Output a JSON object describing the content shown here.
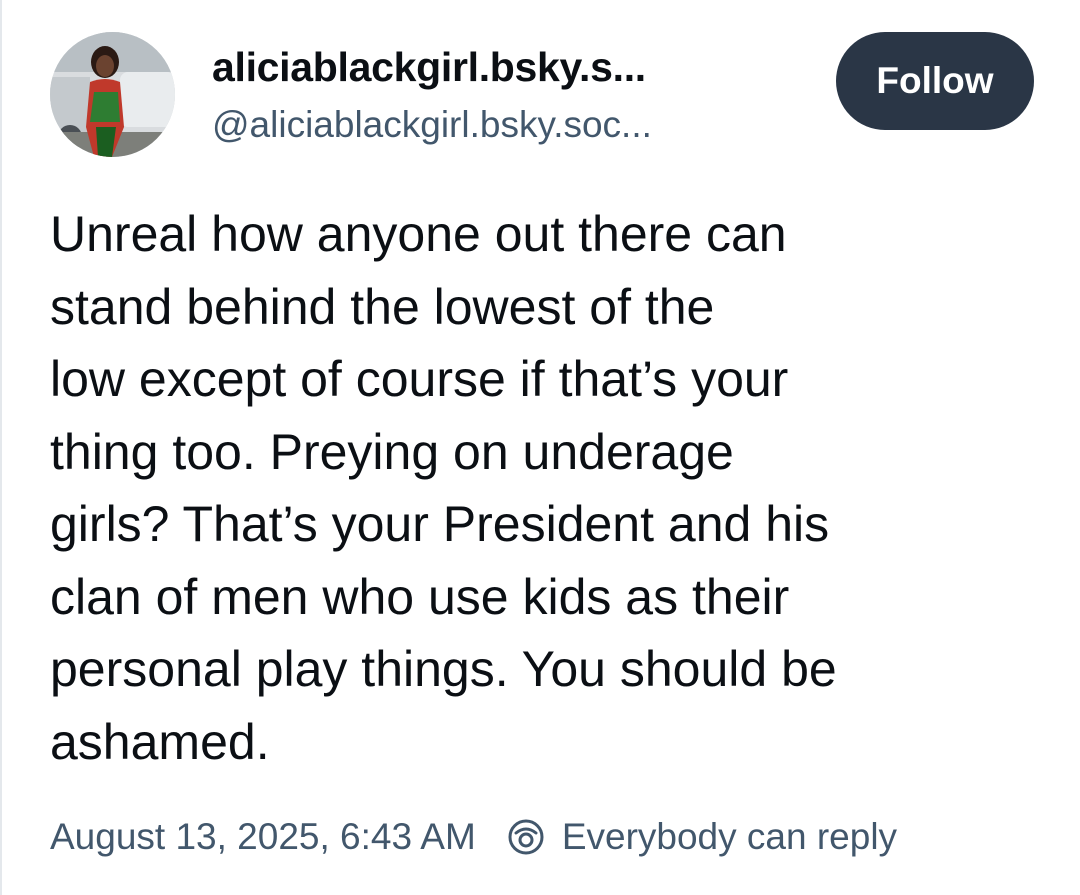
{
  "post": {
    "author": {
      "display_name": "aliciablackgirl.bsky.s...",
      "handle": "@aliciablackgirl.bsky.soc..."
    },
    "follow_label": "Follow",
    "body_lines": [
      "Unreal how anyone out there can",
      "stand behind the lowest of the",
      "low except of course if that’s your",
      "thing too. Preying on underage",
      "girls? That’s your President and his",
      "clan of men who use kids as their",
      "personal play things. You should be",
      "ashamed."
    ],
    "timestamp": "August 13, 2025, 6:43 AM",
    "reply_setting": "Everybody can reply",
    "reply_icon": "reply-restriction-icon"
  },
  "colors": {
    "follow_bg": "#2a3646",
    "text_primary": "#0b0f14",
    "text_secondary": "#42576c"
  }
}
